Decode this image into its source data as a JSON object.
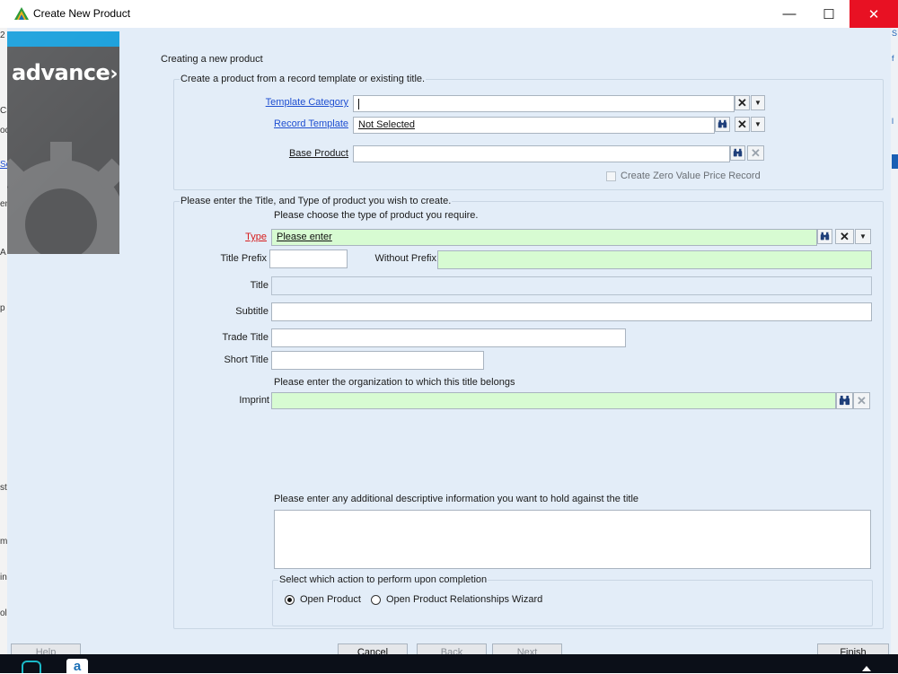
{
  "window": {
    "title": "Create New Product",
    "minimize": "—",
    "maximize": "☐",
    "close": "✕"
  },
  "left_strip_chars": [
    "2",
    "Cr",
    "oc",
    "Se",
    "en",
    "A",
    "p",
    "st",
    "m",
    "in",
    "ol"
  ],
  "right_strip_chars": [
    "S",
    "f",
    "l"
  ],
  "banner": {
    "logo_text": "advance"
  },
  "intro": {
    "heading": "Creating a new product"
  },
  "template_group": {
    "legend": "Create a product from a record template or existing title.",
    "template_category": {
      "label": "Template Category",
      "value": ""
    },
    "record_template": {
      "label": "Record Template",
      "value": "Not Selected"
    },
    "base_product": {
      "label": "Base Product",
      "value": ""
    },
    "zero_price": {
      "label": "Create Zero Value Price Record",
      "checked": false
    }
  },
  "title_group": {
    "legend": "Please enter the Title, and Type of product you wish to create.",
    "type_hint": "Please choose the type of product you require.",
    "type": {
      "label": "Type",
      "value": "Please enter"
    },
    "title_prefix": {
      "label": "Title Prefix",
      "value": ""
    },
    "without_prefix": {
      "label": "Without Prefix",
      "value": ""
    },
    "title": {
      "label": "Title",
      "value": ""
    },
    "subtitle": {
      "label": "Subtitle",
      "value": ""
    },
    "trade_title": {
      "label": "Trade Title",
      "value": ""
    },
    "short_title": {
      "label": "Short Title",
      "value": ""
    },
    "org_hint": "Please enter the organization to which this title belongs",
    "imprint": {
      "label": "Imprint",
      "value": ""
    },
    "desc_hint": "Please enter any additional descriptive information you want to hold against the title",
    "description": ""
  },
  "completion": {
    "legend": "Select which action to perform upon completion",
    "options": [
      {
        "label": "Open Product",
        "selected": true
      },
      {
        "label": "Open Product Relationships Wizard",
        "selected": false
      }
    ]
  },
  "buttons": {
    "help": "Help",
    "cancel": "Cancel",
    "back": "Back",
    "next": "Next",
    "finish": "Finish"
  },
  "icons": {
    "app": "app-logo-icon",
    "binoculars": "binoculars-icon",
    "clear": "clear-x-icon",
    "dropdown": "chevron-down-icon"
  },
  "colors": {
    "accent": "#1aa0dc",
    "banner": "#58595b",
    "required_fill": "#d7fbd2",
    "panel": "#e3edf8",
    "close_red": "#e81123",
    "link_blue": "#1f4fd1",
    "required_label": "#d61c1c"
  }
}
